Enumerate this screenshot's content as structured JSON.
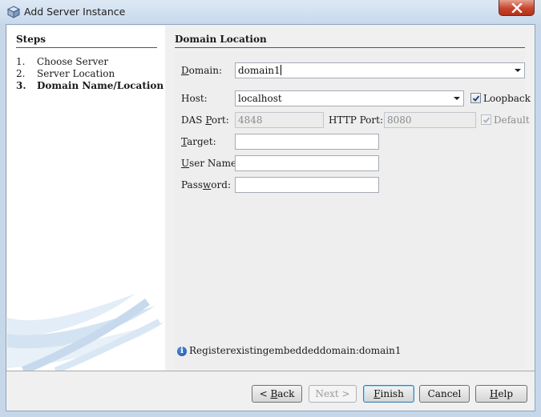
{
  "window": {
    "title": "Add Server Instance"
  },
  "steps": {
    "heading": "Steps",
    "items": [
      {
        "num": "1.",
        "label": "Choose Server"
      },
      {
        "num": "2.",
        "label": "Server Location"
      },
      {
        "num": "3.",
        "label": "Domain Name/Location"
      }
    ]
  },
  "panel": {
    "heading": "Domain Location",
    "domain": {
      "label_pre": "",
      "label_key": "D",
      "label_post": "omain:",
      "value": "domain1"
    },
    "host": {
      "label": "Host:",
      "value": "localhost"
    },
    "loopback": {
      "label": "Loopback",
      "checked": true
    },
    "das_port": {
      "label_pre": "DAS ",
      "label_key": "P",
      "label_post": "ort:",
      "value": "4848"
    },
    "http_port": {
      "label": "HTTP Port:",
      "value": "8080"
    },
    "default_chk": {
      "label": "Default",
      "checked": true
    },
    "target": {
      "label_pre": "",
      "label_key": "T",
      "label_post": "arget:",
      "value": ""
    },
    "user_name": {
      "label_pre": "",
      "label_key": "U",
      "label_post": "ser Name:",
      "value": ""
    },
    "password": {
      "label_pre": "Pass",
      "label_key": "w",
      "label_post": "ord:",
      "value": ""
    },
    "info_message": "Registerexistingembeddeddomain:domain1"
  },
  "buttons": {
    "back": {
      "pre": "< ",
      "key": "B",
      "post": "ack"
    },
    "next": "Next >",
    "finish": {
      "key": "F",
      "post": "inish"
    },
    "cancel": "Cancel",
    "help": {
      "key": "H",
      "post": "elp"
    }
  },
  "colors": {
    "window_frame": "#c6d7ea",
    "close_button": "#c7452e",
    "panel_bg": "#eeeeee",
    "default_button_border": "#3c7fb1"
  }
}
